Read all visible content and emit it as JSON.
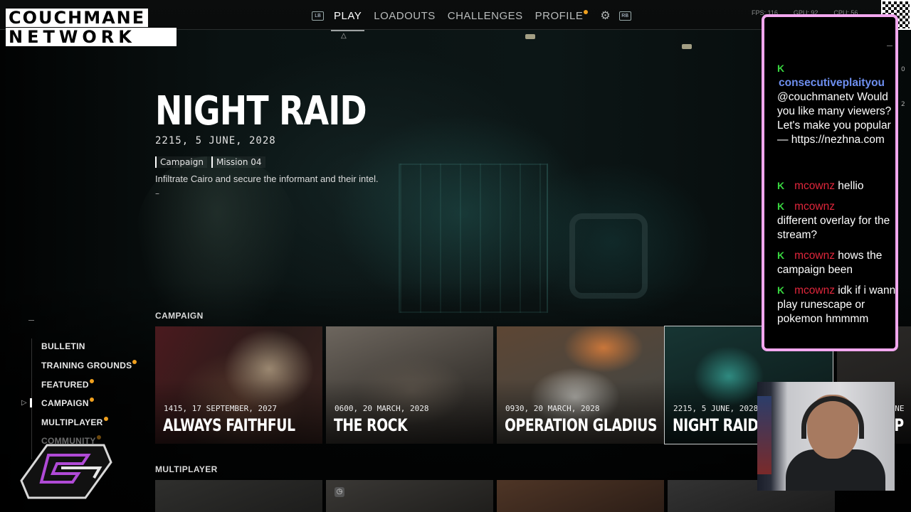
{
  "topnav": {
    "lb": "LB",
    "items": [
      {
        "label": "PLAY",
        "active": true
      },
      {
        "label": "LOADOUTS",
        "active": false
      },
      {
        "label": "CHALLENGES",
        "active": false
      },
      {
        "label": "PROFILE",
        "active": false
      }
    ],
    "rb": "RB",
    "stats": [
      "FPS: 116",
      "GPU: 92",
      "CPU: 56"
    ]
  },
  "logo": {
    "line1": "COUCHMANE",
    "line2": "NETWORK"
  },
  "mission": {
    "title": "NIGHT RAID",
    "date": "2215, 5 JUNE, 2028",
    "tags": [
      "Campaign",
      "Mission 04"
    ],
    "description": "Infiltrate Cairo and secure the informant and their intel.",
    "dash": "–"
  },
  "leftmenu": {
    "items": [
      {
        "label": "BULLETIN",
        "dot": false
      },
      {
        "label": "TRAINING GROUNDS",
        "dot": true
      },
      {
        "label": "FEATURED",
        "dot": true
      },
      {
        "label": "CAMPAIGN",
        "dot": true,
        "selected": true
      },
      {
        "label": "MULTIPLAYER",
        "dot": true
      },
      {
        "label": "COMMUNITY",
        "dot": true
      }
    ]
  },
  "sections": {
    "campaign": "CAMPAIGN",
    "multiplayer": "MULTIPLAYER"
  },
  "campaign_cards": [
    {
      "date": "1415, 17 SEPTEMBER, 2027",
      "title": "ALWAYS FAITHFUL"
    },
    {
      "date": "0600, 20 MARCH, 2028",
      "title": "THE ROCK"
    },
    {
      "date": "0930, 20 MARCH, 2028",
      "title": "OPERATION GLADIUS"
    },
    {
      "date": "2215, 5 JUNE, 2028",
      "title": "NIGHT RAID"
    },
    {
      "date": "JUNE",
      "title": "EP"
    }
  ],
  "chat": {
    "messages": [
      {
        "user": "consecutiveplaityou",
        "text": "@couchmanetv Would you like many viewers? Let's make you popular — https://nezhna.com",
        "style": "blue"
      },
      {
        "user": "mcownz",
        "text": "hellio",
        "style": "red"
      },
      {
        "user": "mcownz",
        "text": "different overlay for the stream?",
        "style": "red"
      },
      {
        "user": "mcownz",
        "text": "hows the campaign been",
        "style": "red"
      },
      {
        "user": "mcownz",
        "text": "idk if i wanna play runescape or pokemon hmmmm",
        "style": "red"
      }
    ]
  },
  "side_counts": [
    "0",
    "2"
  ],
  "colors": {
    "accent_orange": "#f0a01e",
    "chat_border": "#f2a7ef",
    "twitch_k": "#38d63f",
    "user_red": "#e0263b",
    "user_blue": "#6e8ff0"
  }
}
